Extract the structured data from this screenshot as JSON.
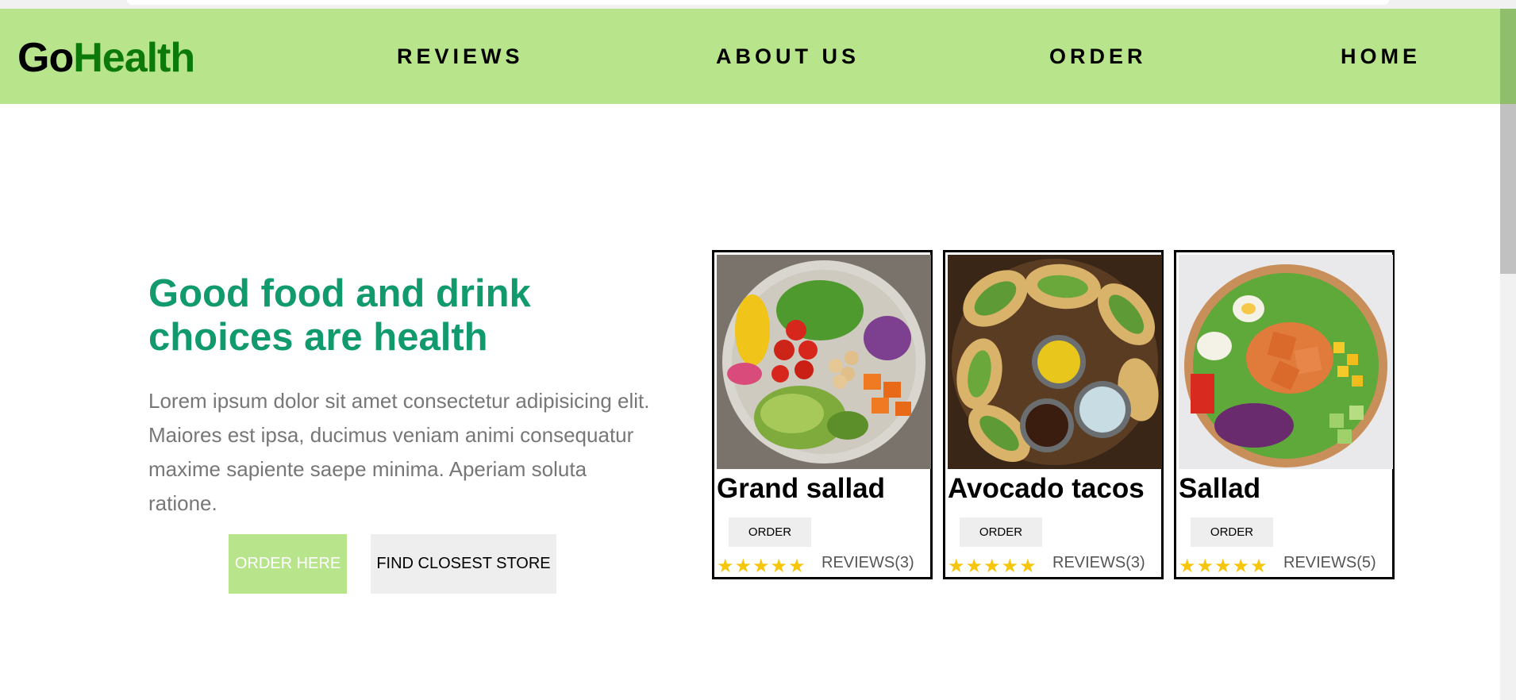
{
  "navbar": {
    "logo_part1": "Go",
    "logo_part2": "Health",
    "links": [
      "REVIEWS",
      "ABOUT US",
      "ORDER",
      "HOME"
    ]
  },
  "hero": {
    "title": "Good food and drink choices are health",
    "text": "Lorem ipsum dolor sit amet consectetur adipisicing elit. Maiores est ipsa, ducimus veniam animi consequatur maxime sapiente saepe minima. Aperiam soluta ratione.",
    "order_button": "ORDER HERE",
    "store_button": "FIND CLOSEST STORE"
  },
  "cards": [
    {
      "name": "Grand sallad",
      "order_label": "ORDER",
      "stars": "★★★★★",
      "rating": 5,
      "reviews": "REVIEWS(3)",
      "image_icon": "salad-bowl-image"
    },
    {
      "name": "Avocado tacos",
      "order_label": "ORDER",
      "stars": "★★★★★",
      "rating": 5,
      "reviews": "REVIEWS(3)",
      "image_icon": "tacos-platter-image"
    },
    {
      "name": "Sallad",
      "order_label": "ORDER",
      "stars": "★★★★★",
      "rating": 5,
      "reviews": "REVIEWS(5)",
      "image_icon": "salmon-salad-image"
    }
  ],
  "colors": {
    "nav_bg": "#b8e58c",
    "logo_green": "#0b7a0b",
    "title_green": "#119a6d",
    "star_yellow": "#f5c60b",
    "button_grey": "#eeeeee"
  }
}
